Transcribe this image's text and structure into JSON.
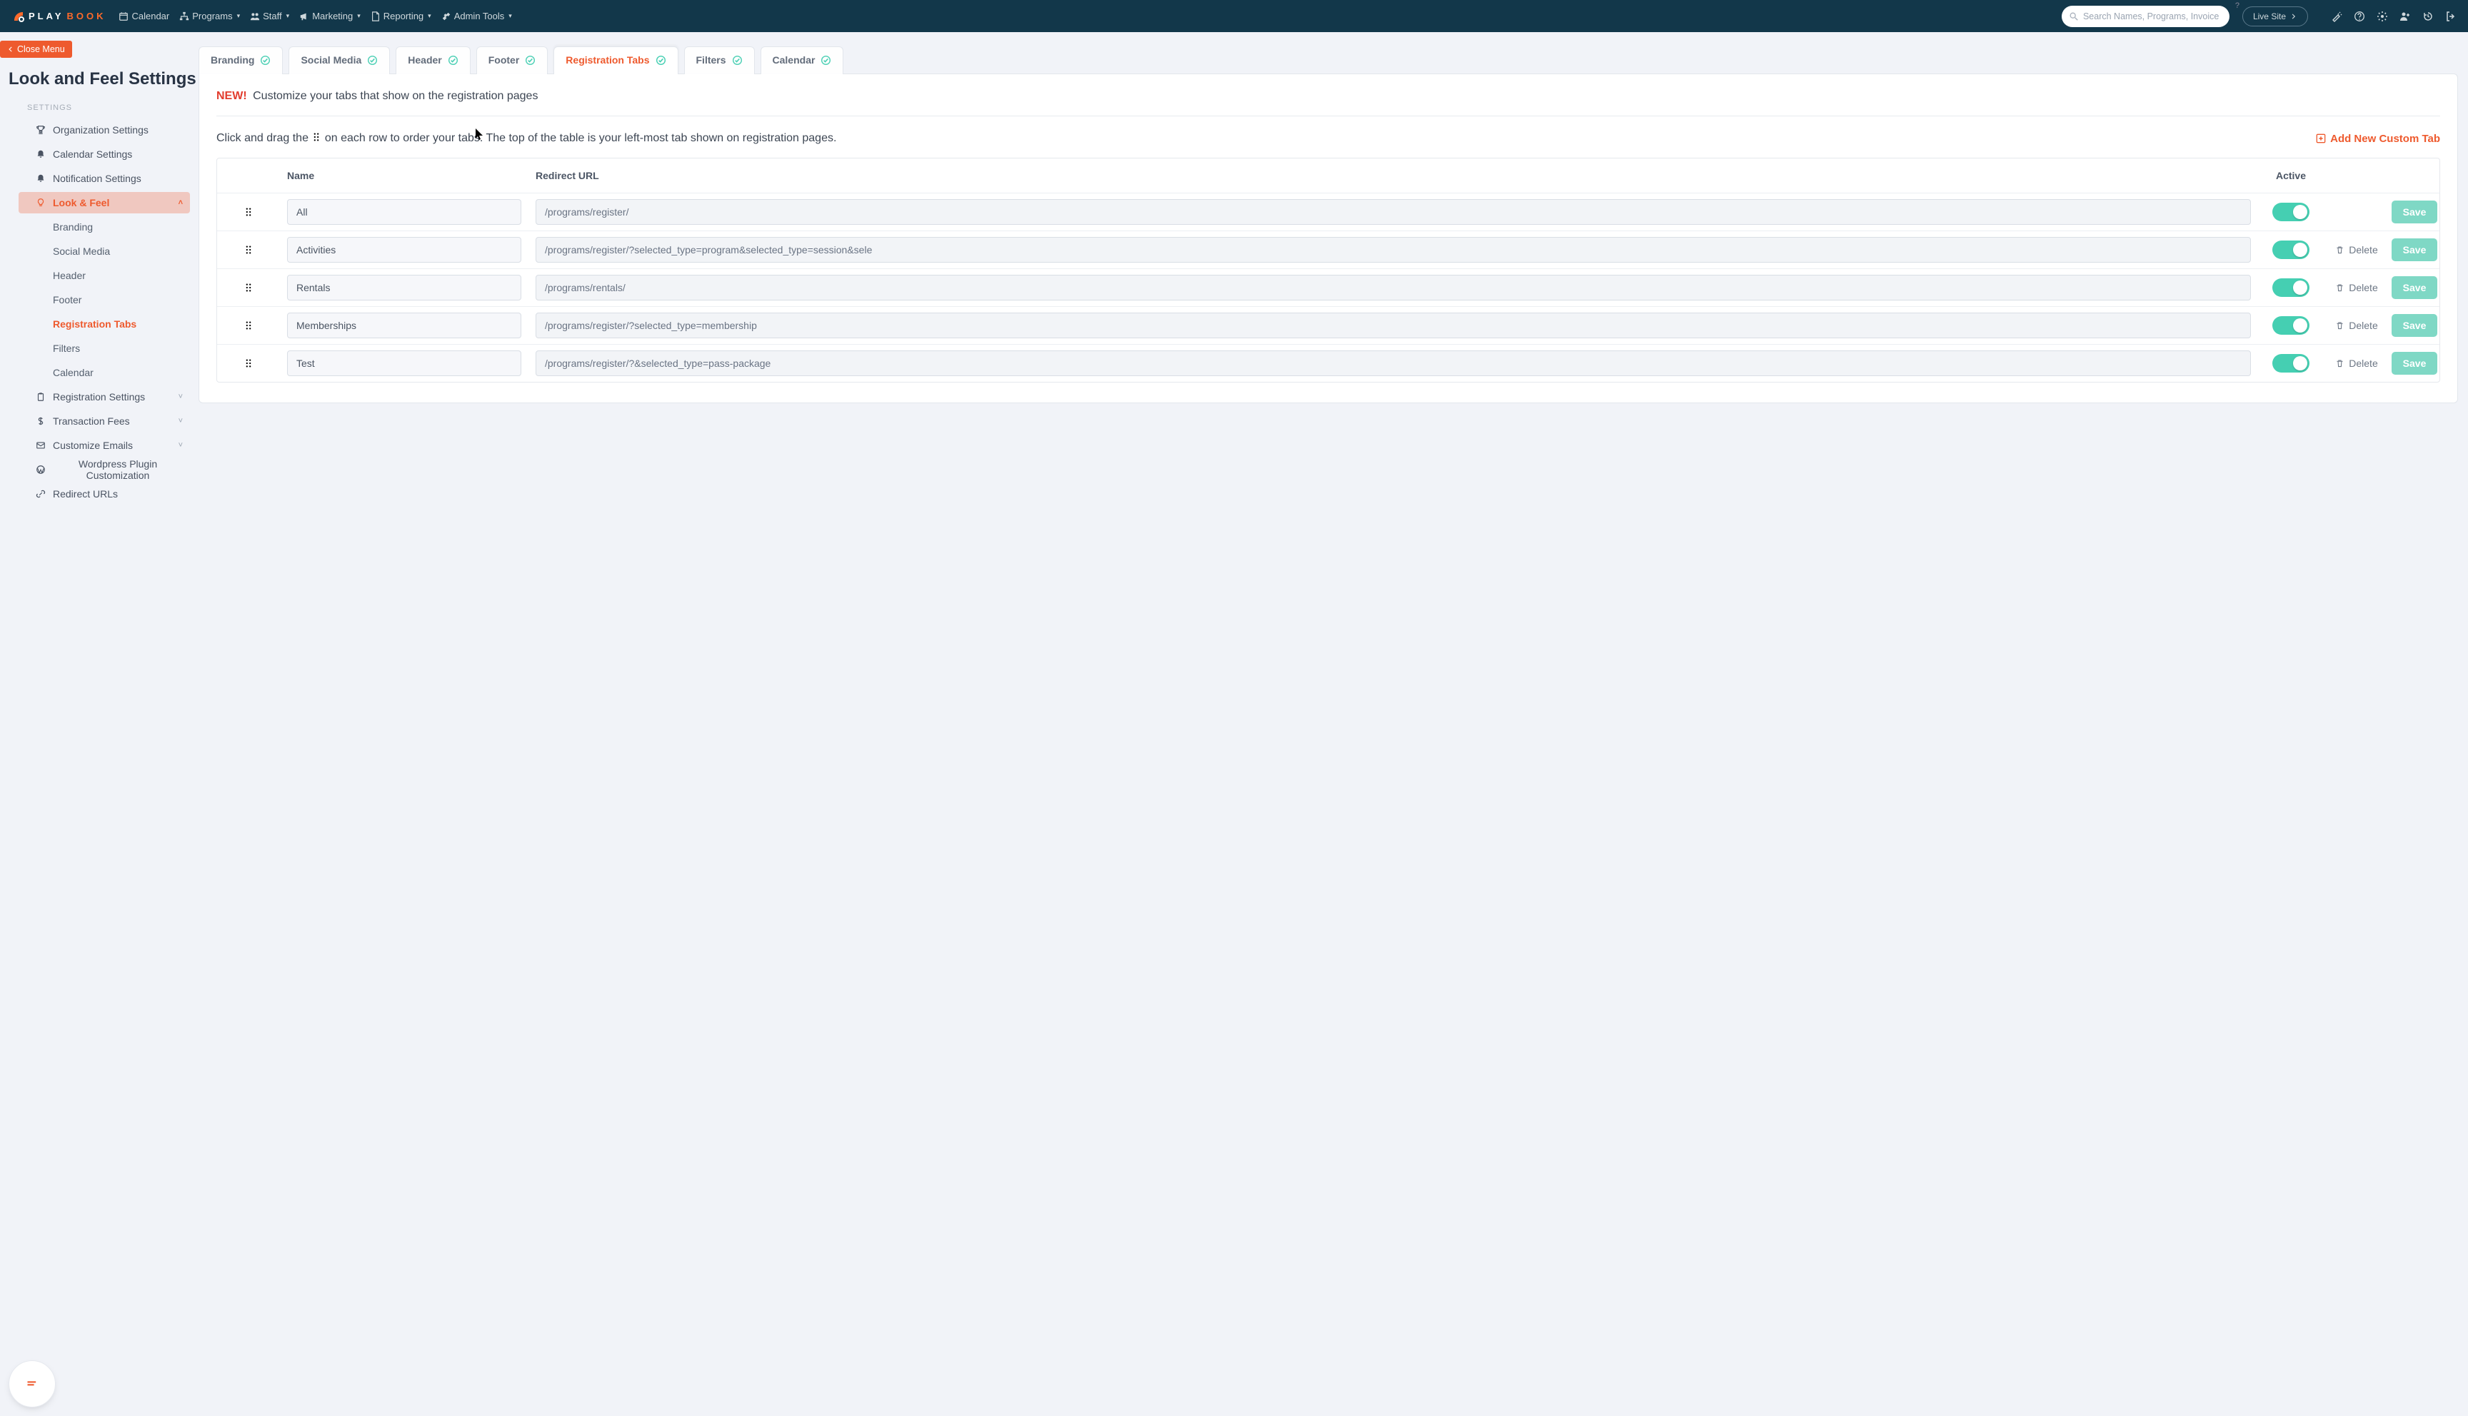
{
  "brand": {
    "play": "PLAY",
    "book": "BOOK"
  },
  "topnav": [
    {
      "icon": "calendar",
      "label": "Calendar",
      "caret": false
    },
    {
      "icon": "sitemap",
      "label": "Programs",
      "caret": true
    },
    {
      "icon": "users",
      "label": "Staff",
      "caret": true
    },
    {
      "icon": "bullhorn",
      "label": "Marketing",
      "caret": true
    },
    {
      "icon": "file",
      "label": "Reporting",
      "caret": true
    },
    {
      "icon": "tools",
      "label": "Admin Tools",
      "caret": true
    }
  ],
  "search": {
    "placeholder": "Search Names, Programs, Invoice #..."
  },
  "live_site": "Live Site",
  "close_menu": "Close Menu",
  "page_title": "Look and Feel Settings",
  "side_section": "SETTINGS",
  "sidebar": [
    {
      "icon": "trophy",
      "label": "Organization Settings"
    },
    {
      "icon": "bell",
      "label": "Calendar Settings"
    },
    {
      "icon": "bell",
      "label": "Notification Settings"
    },
    {
      "icon": "bulb",
      "label": "Look & Feel",
      "active": true,
      "children": [
        "Branding",
        "Social Media",
        "Header",
        "Footer",
        "Registration Tabs",
        "Filters",
        "Calendar"
      ],
      "current_child": 4
    },
    {
      "icon": "clipboard",
      "label": "Registration Settings",
      "chev": true
    },
    {
      "icon": "dollar",
      "label": "Transaction Fees",
      "chev": true
    },
    {
      "icon": "mail",
      "label": "Customize Emails",
      "chev": true
    },
    {
      "icon": "wordpress",
      "label": "Wordpress Plugin Customization"
    },
    {
      "icon": "link",
      "label": "Redirect URLs"
    }
  ],
  "tabs": [
    {
      "label": "Branding"
    },
    {
      "label": "Social Media"
    },
    {
      "label": "Header"
    },
    {
      "label": "Footer"
    },
    {
      "label": "Registration Tabs",
      "active": true
    },
    {
      "label": "Filters"
    },
    {
      "label": "Calendar"
    }
  ],
  "banner_new": "NEW!",
  "banner_text": "Customize your tabs that show on the registration pages",
  "instruction_a": "Click and drag the ",
  "instruction_b": " on each row to order your tabs. The top of the table is your left-most tab shown on registration pages.",
  "add_tab": "Add New Custom Tab",
  "columns": {
    "name": "Name",
    "url": "Redirect URL",
    "active": "Active"
  },
  "delete_label": "Delete",
  "save_label": "Save",
  "rows": [
    {
      "name": "All",
      "url": "/programs/register/",
      "deletable": false
    },
    {
      "name": "Activities",
      "url": "/programs/register/?selected_type=program&selected_type=session&sele",
      "deletable": true
    },
    {
      "name": "Rentals",
      "url": "/programs/rentals/",
      "deletable": true
    },
    {
      "name": "Memberships",
      "url": "/programs/register/?selected_type=membership",
      "deletable": true
    },
    {
      "name": "Test",
      "url": "/programs/register/?&selected_type=pass-package",
      "deletable": true
    }
  ]
}
